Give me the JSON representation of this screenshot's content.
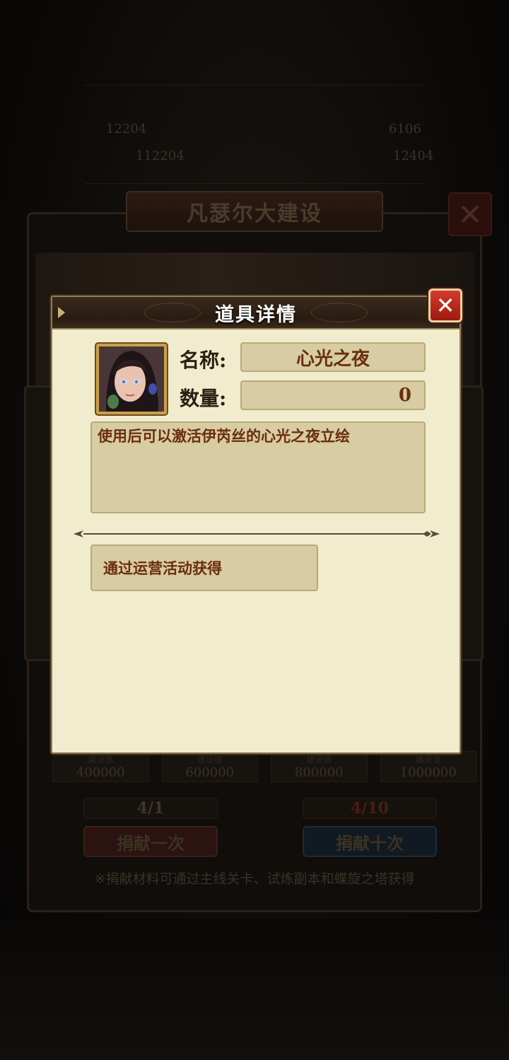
{
  "background": {
    "title": "凡瑟尔大建设",
    "stats": [
      "12204",
      "112204",
      "6106",
      "12404"
    ],
    "milestones": [
      {
        "label": "建设值",
        "value": "400000"
      },
      {
        "label": "建设值",
        "value": "600000"
      },
      {
        "label": "建设值",
        "value": "800000"
      },
      {
        "label": "建设值",
        "value": "1000000"
      }
    ],
    "count_left": "4/1",
    "count_right": "4/10",
    "donate_once": "捐献一次",
    "donate_ten": "捐献十次",
    "note": "※捐献材料可通过主线关卡、试炼副本和蝶旋之塔获得"
  },
  "dialog": {
    "title": "道具详情",
    "close_symbol": "✕",
    "name_label": "名称:",
    "name_value": "心光之夜",
    "quantity_label": "数量:",
    "quantity_value": "0",
    "description": "使用后可以激活伊芮丝的心光之夜立绘",
    "source": "通过运营活动获得"
  },
  "colors": {
    "dialog_bg": "#f1eccd",
    "field_bg": "#d7cca2",
    "text_brown": "#6a2d0e",
    "close_red": "#c0281c"
  }
}
